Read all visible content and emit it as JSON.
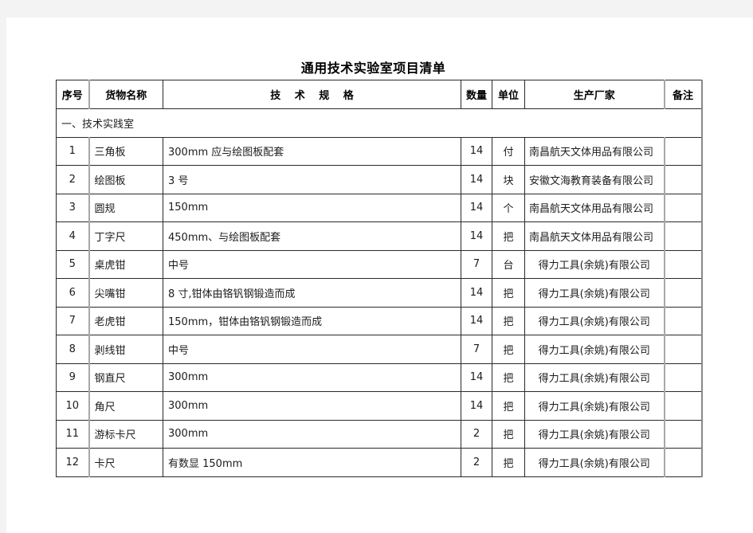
{
  "document": {
    "title": "通用技术实验室项目清单"
  },
  "table": {
    "headers": {
      "index": "序号",
      "name": "货物名称",
      "spec": "技　 术　  规　 格",
      "qty": "数量",
      "unit": "单位",
      "maker": "生产厂家",
      "note": "备注"
    },
    "section": {
      "label": "一、技术实践室"
    },
    "rows": [
      {
        "index": "1",
        "name": "三角板",
        "spec": "300mm 应与绘图板配套",
        "qty": "14",
        "unit": "付",
        "maker": "南昌航天文体用品有限公司",
        "note": ""
      },
      {
        "index": "2",
        "name": "绘图板",
        "spec": "3 号",
        "qty": "14",
        "unit": "块",
        "maker": "安徽文海教育装备有限公司",
        "note": ""
      },
      {
        "index": "3",
        "name": "圆规",
        "spec": "150mm",
        "qty": "14",
        "unit": "个",
        "maker": "南昌航天文体用品有限公司",
        "note": ""
      },
      {
        "index": "4",
        "name": "丁字尺",
        "spec": "450mm、与绘图板配套",
        "qty": "14",
        "unit": "把",
        "maker": "南昌航天文体用品有限公司",
        "note": ""
      },
      {
        "index": "5",
        "name": "桌虎钳",
        "spec": "中号",
        "qty": "7",
        "unit": "台",
        "maker": "得力工具(余姚)有限公司",
        "note": ""
      },
      {
        "index": "6",
        "name": "尖嘴钳",
        "spec": "8 寸,钳体由铬钒钢锻造而成",
        "qty": "14",
        "unit": "把",
        "maker": "得力工具(余姚)有限公司",
        "note": ""
      },
      {
        "index": "7",
        "name": "老虎钳",
        "spec": "150mm，钳体由铬钒钢锻造而成",
        "qty": "14",
        "unit": "把",
        "maker": "得力工具(余姚)有限公司",
        "note": ""
      },
      {
        "index": "8",
        "name": "剥线钳",
        "spec": "中号",
        "qty": "7",
        "unit": "把",
        "maker": "得力工具(余姚)有限公司",
        "note": ""
      },
      {
        "index": "9",
        "name": "钢直尺",
        "spec": "300mm",
        "qty": "14",
        "unit": "把",
        "maker": "得力工具(余姚)有限公司",
        "note": ""
      },
      {
        "index": "10",
        "name": "角尺",
        "spec": "300mm",
        "qty": "14",
        "unit": "把",
        "maker": "得力工具(余姚)有限公司",
        "note": ""
      },
      {
        "index": "11",
        "name": "游标卡尺",
        "spec": "300mm",
        "qty": "2",
        "unit": "把",
        "maker": "得力工具(余姚)有限公司",
        "note": ""
      },
      {
        "index": "12",
        "name": "卡尺",
        "spec": "有数显 150mm",
        "qty": "2",
        "unit": "把",
        "maker": "得力工具(余姚)有限公司",
        "note": ""
      }
    ]
  }
}
